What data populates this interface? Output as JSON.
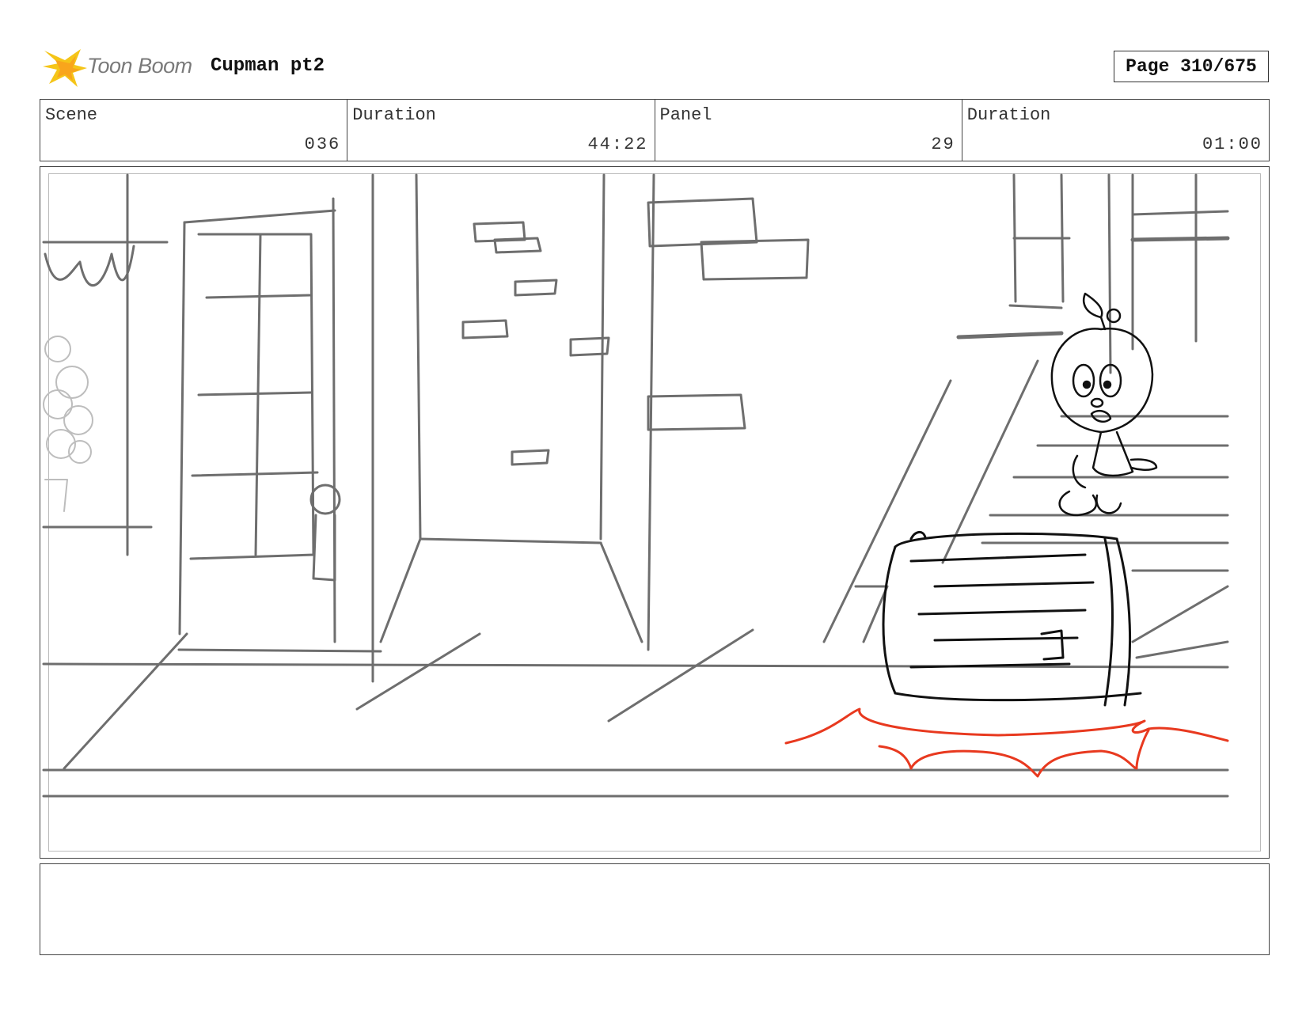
{
  "header": {
    "logo_text": "Toon Boom",
    "logo_icon": "star-burst-icon",
    "title": "Cupman pt2",
    "page_label": "Page 310/675"
  },
  "info": {
    "scene_label": "Scene",
    "scene_value": "036",
    "scene_duration_label": "Duration",
    "scene_duration_value": "44:22",
    "panel_label": "Panel",
    "panel_value": "29",
    "panel_duration_label": "Duration",
    "panel_duration_value": "01:00"
  },
  "notes": {
    "text": ""
  },
  "colors": {
    "sketch_gray": "#6e6e6e",
    "ink_black": "#111111",
    "splash_red": "#e8391f",
    "logo_yellow": "#f5c518"
  }
}
